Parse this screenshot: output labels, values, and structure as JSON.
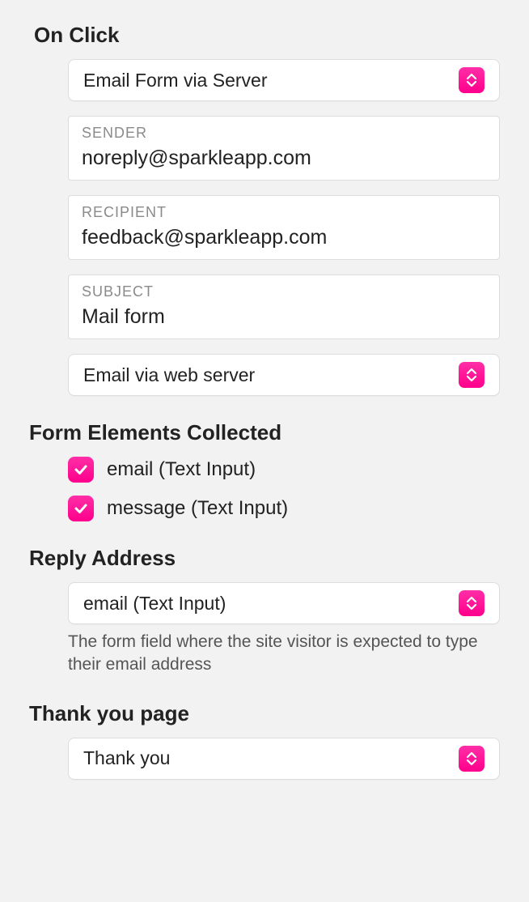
{
  "onClick": {
    "heading": "On Click",
    "actionSelect": "Email Form via Server",
    "sender": {
      "label": "SENDER",
      "value": "noreply@sparkleapp.com"
    },
    "recipient": {
      "label": "RECIPIENT",
      "value": "feedback@sparkleapp.com"
    },
    "subject": {
      "label": "SUBJECT",
      "value": "Mail form"
    },
    "methodSelect": "Email via web server"
  },
  "formElements": {
    "heading": "Form Elements Collected",
    "items": [
      {
        "label": "email (Text Input)",
        "checked": true
      },
      {
        "label": "message (Text Input)",
        "checked": true
      }
    ]
  },
  "replyAddress": {
    "heading": "Reply Address",
    "select": "email (Text Input)",
    "help": "The form field where the site visitor is expected to type their email address"
  },
  "thankYou": {
    "heading": "Thank you page",
    "select": "Thank you"
  }
}
